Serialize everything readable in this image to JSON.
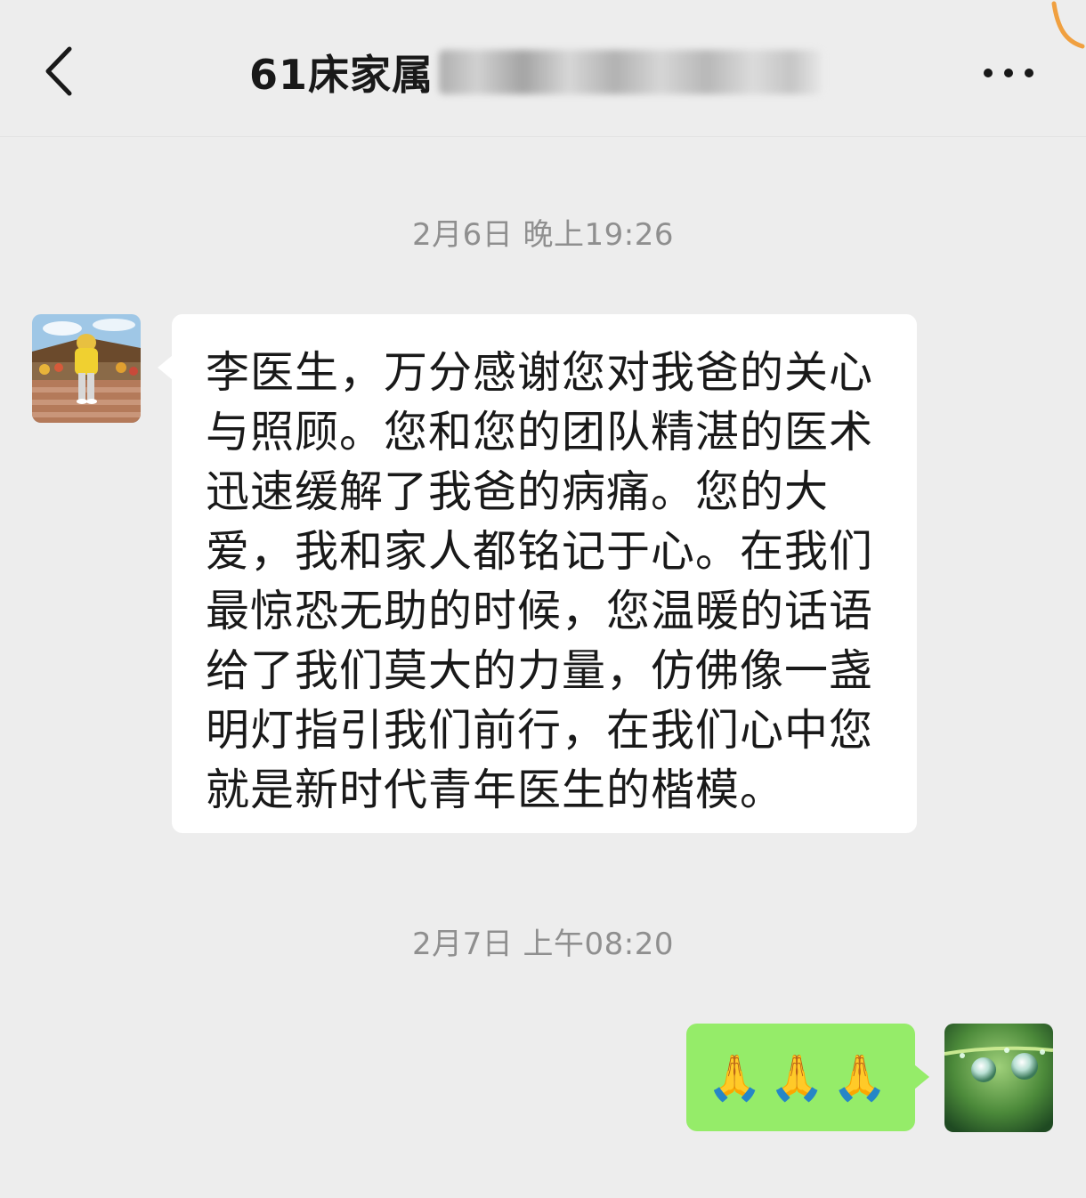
{
  "header": {
    "title": "61床家属",
    "back_icon": "back-chevron-icon",
    "more_icon": "more-dots-icon"
  },
  "messages": [
    {
      "timestamp": "2月6日 晚上19:26",
      "side": "left",
      "text": "李医生，万分感谢您对我爸的关心与照顾。您和您的团队精湛的医术迅速缓解了我爸的病痛。您的大爱，我和家人都铭记于心。在我们最惊恐无助的时候，您温暖的话语给了我们莫大的力量，仿佛像一盏明灯指引我们前行，在我们心中您就是新时代青年医生的楷模。"
    },
    {
      "timestamp": "2月7日 上午08:20",
      "side": "right",
      "text": "🙏🙏🙏"
    }
  ],
  "colors": {
    "background": "#ededed",
    "incoming_bubble": "#ffffff",
    "outgoing_bubble": "#95ec69",
    "timestamp_text": "#8f8f8f",
    "primary_text": "#191919"
  }
}
